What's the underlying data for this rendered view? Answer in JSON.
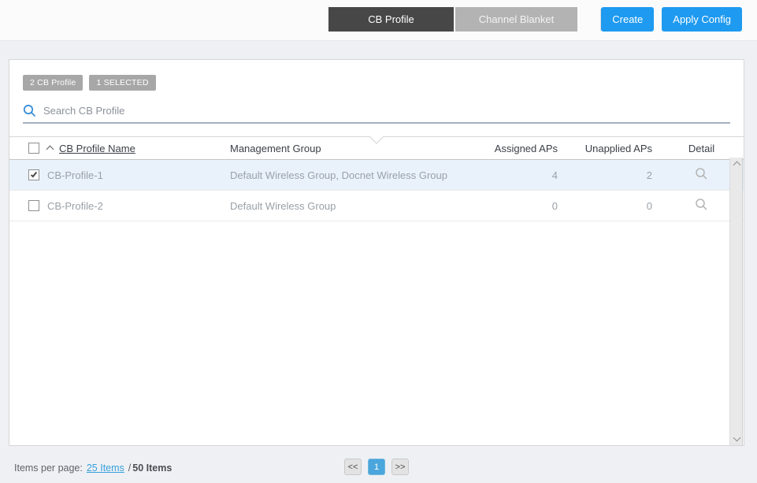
{
  "topbar": {
    "tabs": [
      {
        "label": "CB Profile",
        "active": true
      },
      {
        "label": "Channel Blanket",
        "active": false
      }
    ],
    "actions": [
      {
        "label": "Create"
      },
      {
        "label": "Apply Config"
      }
    ]
  },
  "panel": {
    "badges": [
      {
        "label": "2 CB Profile"
      },
      {
        "label": "1 SELECTED"
      }
    ],
    "search": {
      "placeholder": "Search CB Profile",
      "value": ""
    }
  },
  "table": {
    "headers": {
      "name": "CB Profile Name",
      "name_sort": "ascending",
      "management_group": "Management Group",
      "assigned_aps": "Assigned APs",
      "unapplied_aps": "Unapplied APs",
      "detail": "Detail"
    },
    "rows": [
      {
        "name": "CB-Profile-1",
        "management_group": "Default Wireless Group, Docnet Wireless Group",
        "assigned_aps": 4,
        "unapplied_aps": 2,
        "checked": true,
        "selected": true
      },
      {
        "name": "CB-Profile-2",
        "management_group": "Default Wireless Group",
        "assigned_aps": 0,
        "unapplied_aps": 0,
        "checked": false,
        "selected": false
      }
    ]
  },
  "footer": {
    "items_per_page_label": "Items per page:",
    "page_size_link": "25 Items",
    "separator": "/",
    "total_label": "50 Items",
    "pagination": {
      "prev": "<<",
      "current": "1",
      "next": ">>"
    }
  },
  "icons": {
    "search": "magnifier",
    "detail": "magnifier",
    "sort": "chevron-up",
    "scroll_up": "chevron-up",
    "scroll_down": "chevron-down"
  },
  "colors": {
    "accent_blue": "#1e9af0",
    "pagination_blue": "#4aa6dc",
    "selected_row": "#e9f2fb",
    "active_tab": "#474747",
    "inactive_tab": "#b3b3b3",
    "badge_gray": "#a7a7a7",
    "search_underline": "#a5b1c0"
  }
}
